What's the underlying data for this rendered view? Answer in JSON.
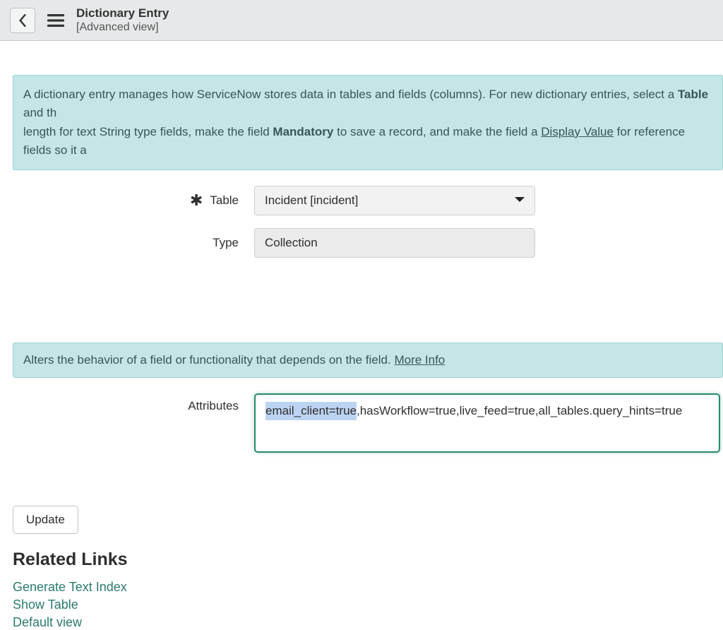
{
  "header": {
    "title": "Dictionary Entry",
    "subtitle": "[Advanced view]"
  },
  "banner1": {
    "text_before_table": "A dictionary entry manages how ServiceNow stores data in tables and fields (columns). For new dictionary entries, select a ",
    "table_word": "Table",
    "text_after_table": " and th",
    "text_line2_before_mandatory": "length for text String type fields, make the field ",
    "mandatory_word": "Mandatory",
    "text_mid": " to save a record, and make the field a ",
    "display_value": "Display Value",
    "text_after_dv": " for reference fields so it a"
  },
  "form": {
    "table_label": "Table",
    "table_value": "Incident [incident]",
    "type_label": "Type",
    "type_value": "Collection"
  },
  "banner2": {
    "text": "Alters the behavior of a field or functionality that depends on the field. ",
    "more": "More Info"
  },
  "attributes": {
    "label": "Attributes",
    "value": "email_client=true,hasWorkflow=true,live_feed=true,all_tables.query_hints=true"
  },
  "buttons": {
    "update": "Update"
  },
  "related": {
    "heading": "Related Links",
    "links": {
      "generate": "Generate Text Index",
      "show": "Show Table",
      "default": "Default view"
    }
  }
}
